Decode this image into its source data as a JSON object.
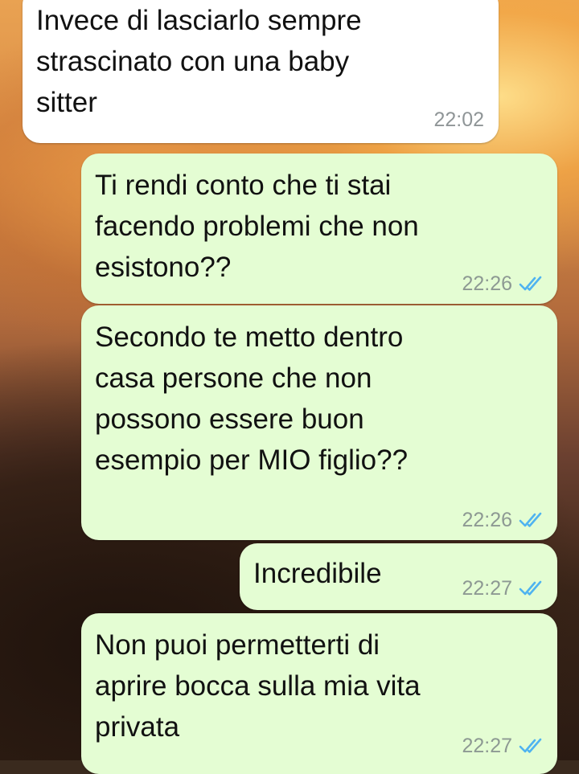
{
  "messages": [
    {
      "direction": "incoming",
      "text": "Invece di lasciarlo sempre\nstrascinato con una baby\nsitter",
      "time": "22:02"
    },
    {
      "direction": "outgoing",
      "text": "Ti rendi conto che ti stai\nfacendo problemi che non\nesistono??",
      "time": "22:26",
      "status": "read"
    },
    {
      "direction": "outgoing",
      "text": "Secondo te metto dentro\ncasa persone che non\npossono essere buon\nesempio per MIO figlio??",
      "time": "22:26",
      "status": "read"
    },
    {
      "direction": "outgoing",
      "text": "Incredibile",
      "time": "22:27",
      "status": "read"
    },
    {
      "direction": "outgoing",
      "text": "Non puoi permetterti di\naprire bocca sulla mia vita\nprivata",
      "time": "22:27",
      "status": "read"
    }
  ],
  "colors": {
    "incoming_bubble": "#ffffff",
    "outgoing_bubble": "#e4fdd3",
    "read_ticks": "#4fb3f0",
    "timestamp": "#8d9993"
  },
  "icons": {
    "read_receipt": "double-check-icon"
  }
}
